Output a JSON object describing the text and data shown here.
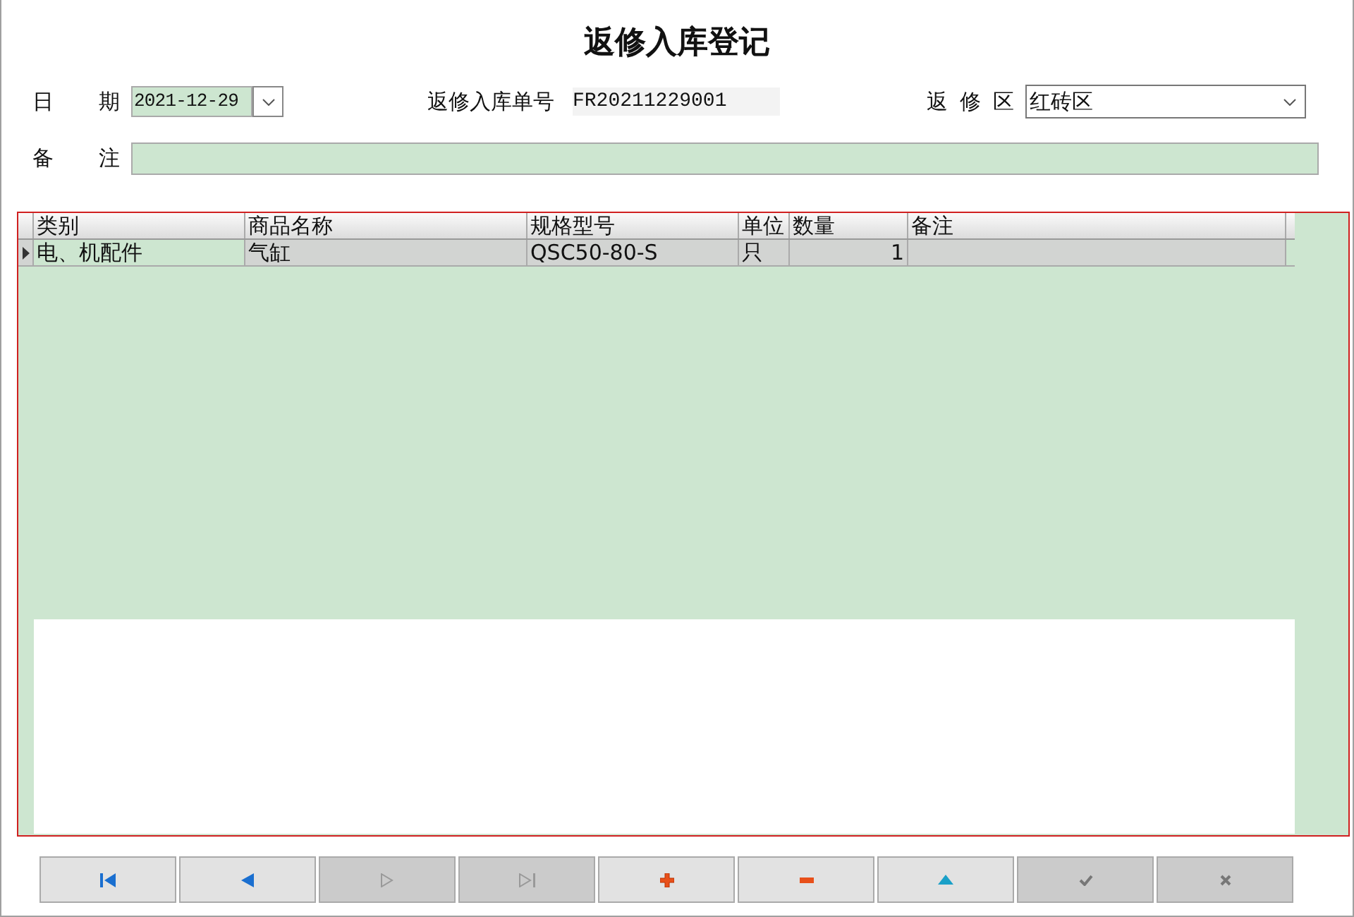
{
  "window": {
    "title": "返修入库登记"
  },
  "fields": {
    "date_label": "日 期",
    "date_value": "2021-12-29",
    "order_label": "返修入库单号",
    "order_value": "FR20211229001",
    "area_label": "返 修 区",
    "area_value": "红砖区",
    "remark_label": "备 注"
  },
  "table": {
    "columns": [
      "类别",
      "商品名称",
      "规格型号",
      "单位",
      "数量",
      "备注"
    ],
    "rows": [
      {
        "selected": true,
        "cells": [
          "电、机配件",
          "气缸",
          "QSC50-80-S",
          "只",
          "1",
          ""
        ]
      }
    ]
  },
  "buttons": [
    {
      "kind": "first",
      "disabled": false
    },
    {
      "kind": "prev",
      "disabled": false
    },
    {
      "kind": "next",
      "disabled": true
    },
    {
      "kind": "last",
      "disabled": true
    },
    {
      "kind": "add",
      "disabled": false
    },
    {
      "kind": "delete",
      "disabled": false
    },
    {
      "kind": "edit",
      "disabled": false
    },
    {
      "kind": "save",
      "disabled": true
    },
    {
      "kind": "cancel",
      "disabled": true
    }
  ]
}
